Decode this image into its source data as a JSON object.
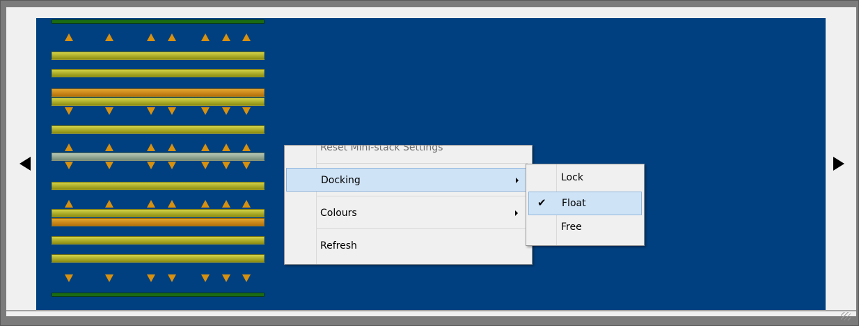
{
  "navigation": {
    "left_arrow_icon": "triangle-left",
    "right_arrow_icon": "triangle-right"
  },
  "context_menu": {
    "items": [
      {
        "label": "Reset Mini-stack Settings",
        "enabled": false
      },
      {
        "label": "Docking",
        "has_submenu": true,
        "highlighted": true
      },
      {
        "label": "Colours",
        "has_submenu": true
      },
      {
        "label": "Refresh"
      }
    ]
  },
  "docking_submenu": {
    "items": [
      {
        "label": "Lock"
      },
      {
        "label": "Float",
        "checked": true,
        "highlighted": true
      },
      {
        "label": "Free"
      }
    ],
    "check_glyph": "✔"
  },
  "colors": {
    "background": "#004080",
    "menu_highlight": "#cfe3f6",
    "bar_green": "#b6b52f",
    "bar_orange": "#d8900f",
    "rail_green": "#1b6b14"
  }
}
